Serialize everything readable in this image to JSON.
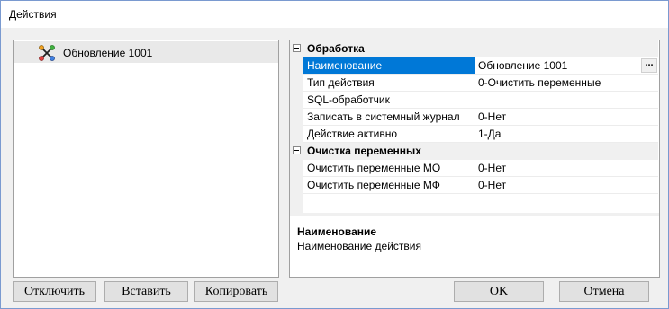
{
  "window": {
    "title": "Действия"
  },
  "tree": {
    "items": [
      {
        "label": "Обновление 1001",
        "icon": "action-node-icon"
      }
    ]
  },
  "property_grid": {
    "categories": [
      {
        "label": "Обработка",
        "properties": [
          {
            "name": "Наименование",
            "value": "Обновление 1001",
            "selected": true,
            "has_button": true,
            "button_label": "..."
          },
          {
            "name": "Тип действия",
            "value": "0-Очистить переменные"
          },
          {
            "name": "SQL-обработчик",
            "value": ""
          },
          {
            "name": "Записать в системный журнал",
            "value": "0-Нет"
          },
          {
            "name": "Действие активно",
            "value": "1-Да"
          }
        ]
      },
      {
        "label": "Очистка переменных",
        "properties": [
          {
            "name": "Очистить переменные МО",
            "value": "0-Нет"
          },
          {
            "name": "Очистить переменные МФ",
            "value": "0-Нет"
          }
        ]
      }
    ],
    "description": {
      "title": "Наименование",
      "text": "Наименование действия"
    }
  },
  "buttons": {
    "disable": "Отключить",
    "insert": "Вставить",
    "copy": "Копировать",
    "ok": "OK",
    "cancel": "Отмена"
  },
  "colors": {
    "selection": "#0078d7",
    "border": "#7a9ad0"
  }
}
